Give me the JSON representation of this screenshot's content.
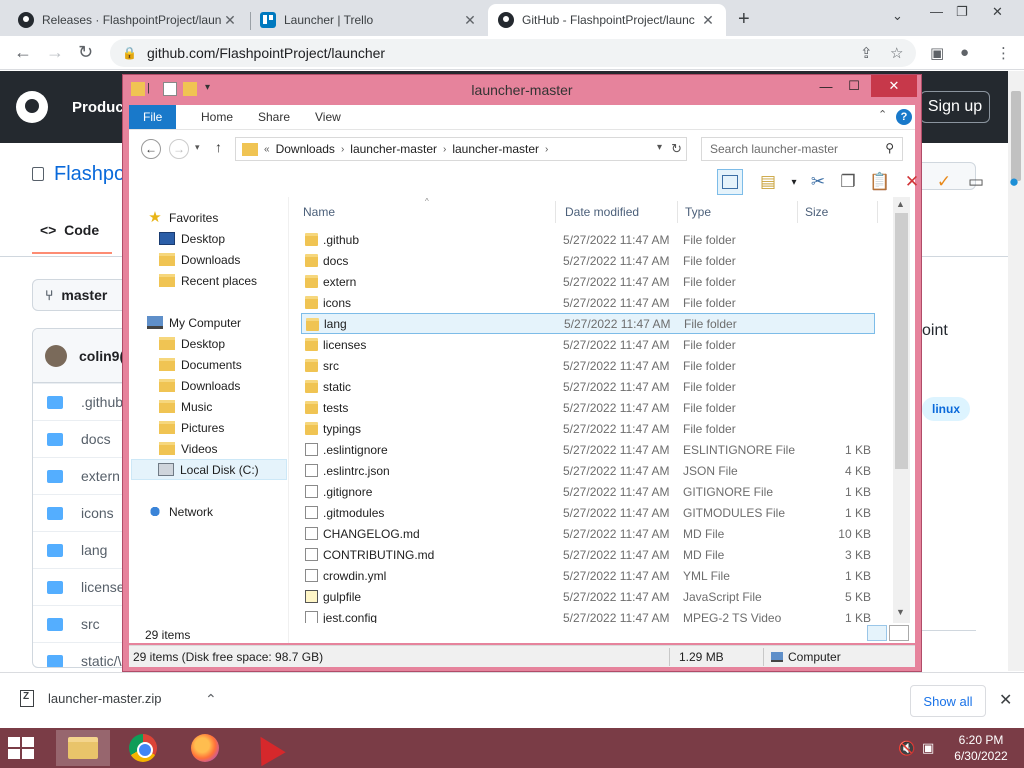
{
  "browser": {
    "tabs": [
      {
        "title": "Releases · FlashpointProject/laun",
        "favicon": "github-icon"
      },
      {
        "title": "Launcher | Trello",
        "favicon": "trello-icon"
      },
      {
        "title": "GitHub - FlashpointProject/launc",
        "favicon": "github-icon",
        "active": true
      }
    ],
    "url": "github.com/FlashpointProject/launcher"
  },
  "github": {
    "products": "Produc",
    "sign_up": "Sign up",
    "repo_name": "Flashpo",
    "code_tab": "Code",
    "branch": "master",
    "commit_user": "colin9(",
    "files": [
      ".github",
      "docs",
      "extern",
      "icons",
      "lang",
      "license",
      "src",
      "static/\\"
    ],
    "about_partial": "oint",
    "topic": "linux"
  },
  "explorer": {
    "title": "launcher-master",
    "ribbon_tabs": [
      "File",
      "Home",
      "Share",
      "View"
    ],
    "breadcrumb": [
      "Downloads",
      "launcher-master",
      "launcher-master"
    ],
    "search_placeholder": "Search launcher-master",
    "nav": {
      "favorites": "Favorites",
      "fav_items": [
        "Desktop",
        "Downloads",
        "Recent places"
      ],
      "computer": "My Computer",
      "pc_items": [
        "Desktop",
        "Documents",
        "Downloads",
        "Music",
        "Pictures",
        "Videos",
        "Local Disk (C:)"
      ],
      "network": "Network"
    },
    "columns": {
      "name": "Name",
      "date": "Date modified",
      "type": "Type",
      "size": "Size"
    },
    "files": [
      {
        "name": ".github",
        "date": "5/27/2022 11:47 AM",
        "type": "File folder",
        "size": "",
        "icon": "folder"
      },
      {
        "name": "docs",
        "date": "5/27/2022 11:47 AM",
        "type": "File folder",
        "size": "",
        "icon": "folder"
      },
      {
        "name": "extern",
        "date": "5/27/2022 11:47 AM",
        "type": "File folder",
        "size": "",
        "icon": "folder"
      },
      {
        "name": "icons",
        "date": "5/27/2022 11:47 AM",
        "type": "File folder",
        "size": "",
        "icon": "folder"
      },
      {
        "name": "lang",
        "date": "5/27/2022 11:47 AM",
        "type": "File folder",
        "size": "",
        "icon": "folder",
        "selected": true
      },
      {
        "name": "licenses",
        "date": "5/27/2022 11:47 AM",
        "type": "File folder",
        "size": "",
        "icon": "folder"
      },
      {
        "name": "src",
        "date": "5/27/2022 11:47 AM",
        "type": "File folder",
        "size": "",
        "icon": "folder"
      },
      {
        "name": "static",
        "date": "5/27/2022 11:47 AM",
        "type": "File folder",
        "size": "",
        "icon": "folder"
      },
      {
        "name": "tests",
        "date": "5/27/2022 11:47 AM",
        "type": "File folder",
        "size": "",
        "icon": "folder"
      },
      {
        "name": "typings",
        "date": "5/27/2022 11:47 AM",
        "type": "File folder",
        "size": "",
        "icon": "folder"
      },
      {
        "name": ".eslintignore",
        "date": "5/27/2022 11:47 AM",
        "type": "ESLINTIGNORE File",
        "size": "1 KB",
        "icon": "file"
      },
      {
        "name": ".eslintrc.json",
        "date": "5/27/2022 11:47 AM",
        "type": "JSON File",
        "size": "4 KB",
        "icon": "file"
      },
      {
        "name": ".gitignore",
        "date": "5/27/2022 11:47 AM",
        "type": "GITIGNORE File",
        "size": "1 KB",
        "icon": "file"
      },
      {
        "name": ".gitmodules",
        "date": "5/27/2022 11:47 AM",
        "type": "GITMODULES File",
        "size": "1 KB",
        "icon": "file"
      },
      {
        "name": "CHANGELOG.md",
        "date": "5/27/2022 11:47 AM",
        "type": "MD File",
        "size": "10 KB",
        "icon": "file"
      },
      {
        "name": "CONTRIBUTING.md",
        "date": "5/27/2022 11:47 AM",
        "type": "MD File",
        "size": "3 KB",
        "icon": "file"
      },
      {
        "name": "crowdin.yml",
        "date": "5/27/2022 11:47 AM",
        "type": "YML File",
        "size": "1 KB",
        "icon": "file"
      },
      {
        "name": "gulpfile",
        "date": "5/27/2022 11:47 AM",
        "type": "JavaScript File",
        "size": "5 KB",
        "icon": "js"
      },
      {
        "name": "jest.config",
        "date": "5/27/2022 11:47 AM",
        "type": "MPEG-2 TS Video",
        "size": "1 KB",
        "icon": "file"
      }
    ],
    "item_count": "29 items",
    "status_left": "29 items (Disk free space: 98.7 GB)",
    "status_size": "1.29 MB",
    "status_location": "Computer"
  },
  "downloads": {
    "file": "launcher-master.zip",
    "show_all": "Show all"
  },
  "taskbar": {
    "time": "6:20 PM",
    "date": "6/30/2022"
  }
}
